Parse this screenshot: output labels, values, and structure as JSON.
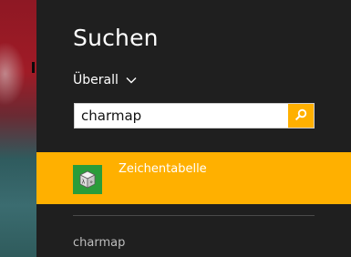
{
  "panel": {
    "title": "Suchen",
    "scope_label": "Überall",
    "search": {
      "value": "charmap",
      "placeholder": ""
    },
    "results": [
      {
        "label": "Zeichentabelle",
        "icon": "charmap-app-icon",
        "highlight_color": "#ffb000"
      }
    ],
    "suggestions": [
      {
        "label": "charmap"
      }
    ]
  },
  "colors": {
    "accent": "#ffb000",
    "panel_bg": "#1f1f1f",
    "tile_green": "#2a9c3a"
  }
}
